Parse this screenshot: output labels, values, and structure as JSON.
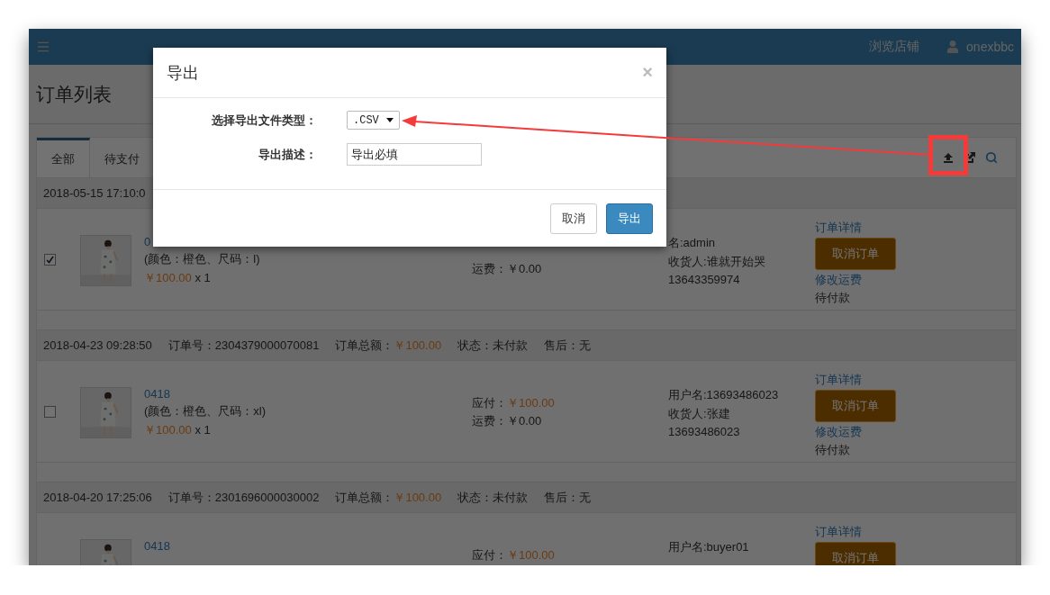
{
  "navbar": {
    "links": [
      "浏览店铺"
    ],
    "user": "onexbbc"
  },
  "page_title": "订单列表",
  "tabs": [
    {
      "label": "全部",
      "selected": true
    },
    {
      "label": "待支付",
      "selected": false
    }
  ],
  "orders": [
    {
      "header": {
        "time": "2018-05-15 17:10:0"
      },
      "checked": true,
      "product": {
        "name": "0",
        "spec": "(颜色：橙色、尺码：l)",
        "price": "￥100.00",
        "qty": "x 1"
      },
      "payment": [
        {
          "label": "运费：",
          "value": "￥0.00",
          "kind": "plain"
        }
      ],
      "buyer": [
        "名:admin",
        "收货人:谁就开始哭",
        "13643359974"
      ],
      "actions": [
        {
          "kind": "link",
          "label": "订单详情"
        },
        {
          "kind": "button",
          "label": "取消订单"
        },
        {
          "kind": "link",
          "label": "修改运费"
        },
        {
          "kind": "text",
          "label": "待付款"
        }
      ]
    },
    {
      "header": {
        "time": "2018-04-23 09:28:50",
        "fields": [
          {
            "label": "订单号：",
            "value": "2304379000070081",
            "kind": "plain"
          },
          {
            "label": "订单总额：",
            "value": "￥100.00",
            "kind": "price"
          },
          {
            "label": "状态：",
            "value": "未付款",
            "kind": "plain"
          },
          {
            "label": "售后：",
            "value": "无",
            "kind": "plain"
          }
        ]
      },
      "checked": false,
      "product": {
        "name": "0418",
        "spec": "(颜色：橙色、尺码：xl)",
        "price": "￥100.00",
        "qty": "x 1"
      },
      "payment": [
        {
          "label": "应付：",
          "value": "￥100.00",
          "kind": "price"
        },
        {
          "label": "运费：",
          "value": "￥0.00",
          "kind": "plain"
        }
      ],
      "buyer": [
        "用户名:13693486023",
        "收货人:张建",
        "13693486023"
      ],
      "actions": [
        {
          "kind": "link",
          "label": "订单详情"
        },
        {
          "kind": "button",
          "label": "取消订单"
        },
        {
          "kind": "link",
          "label": "修改运费"
        },
        {
          "kind": "text",
          "label": "待付款"
        }
      ]
    },
    {
      "header": {
        "time": "2018-04-20 17:25:06",
        "fields": [
          {
            "label": "订单号：",
            "value": "2301696000030002",
            "kind": "plain"
          },
          {
            "label": "订单总额：",
            "value": "￥100.00",
            "kind": "price"
          },
          {
            "label": "状态：",
            "value": "未付款",
            "kind": "plain"
          },
          {
            "label": "售后：",
            "value": "无",
            "kind": "plain"
          }
        ]
      },
      "product": {
        "name": "0418"
      },
      "payment": [
        {
          "label": "应付：",
          "value": "￥100.00",
          "kind": "price"
        }
      ],
      "buyer": [
        "用户名:buyer01"
      ],
      "actions": [
        {
          "kind": "link",
          "label": "订单详情"
        },
        {
          "kind": "button",
          "label": "取消订单"
        }
      ]
    }
  ],
  "modal": {
    "title": "导出",
    "close": "×",
    "fields": [
      {
        "kind": "select",
        "label": "选择导出文件类型：",
        "value": ".CSV"
      },
      {
        "kind": "input",
        "label": "导出描述：",
        "value": "导出必填"
      }
    ],
    "buttons": [
      {
        "label": "取消",
        "kind": "default"
      },
      {
        "label": "导出",
        "kind": "primary"
      }
    ]
  }
}
